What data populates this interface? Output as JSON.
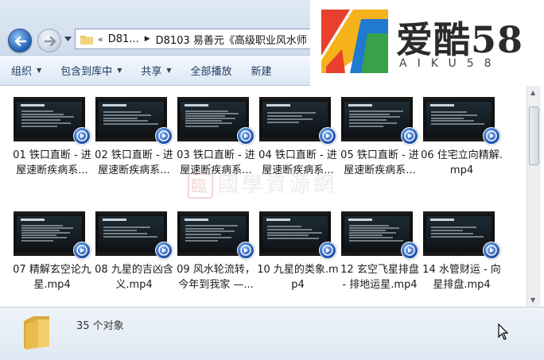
{
  "address": {
    "overflow_marker": "«",
    "crumbs": [
      "D81...",
      "D8103 易善元《高级职业风水师"
    ]
  },
  "logo": {
    "title": "爱酷58",
    "subtitle": "AIKU58"
  },
  "toolbar": {
    "items": [
      {
        "label": "组织",
        "dropdown": true
      },
      {
        "label": "包含到库中",
        "dropdown": true
      },
      {
        "label": "共享",
        "dropdown": true
      },
      {
        "label": "全部播放",
        "dropdown": false
      },
      {
        "label": "新建",
        "dropdown": false
      }
    ]
  },
  "watermark": {
    "seal": "臨",
    "text": "國學資源網"
  },
  "files": [
    {
      "name": "01 铁口直断 - 进屋速断疾病系..."
    },
    {
      "name": "02 铁口直断 - 进屋速断疾病系..."
    },
    {
      "name": "03 铁口直断 - 进屋速断疾病系..."
    },
    {
      "name": "04 铁口直断 - 进屋速断疾病系..."
    },
    {
      "name": "05 铁口直断 - 进屋速断疾病系..."
    },
    {
      "name": "06 住宅立向精解.mp4"
    },
    {
      "name": "07 精解玄空论九星.mp4"
    },
    {
      "name": "08 九星的吉凶含义.mp4"
    },
    {
      "name": "09 风水轮流转，今年到我家 —..."
    },
    {
      "name": "10 九星的类象.mp4"
    },
    {
      "name": "12 玄空飞星排盘 - 排地运星.mp4"
    },
    {
      "name": "14 水管财运 - 向星排盘.mp4"
    }
  ],
  "status": {
    "count_text": "35 个对象"
  },
  "colors": {
    "accent": "#1d4fae",
    "toolbar_text": "#1e395b"
  }
}
